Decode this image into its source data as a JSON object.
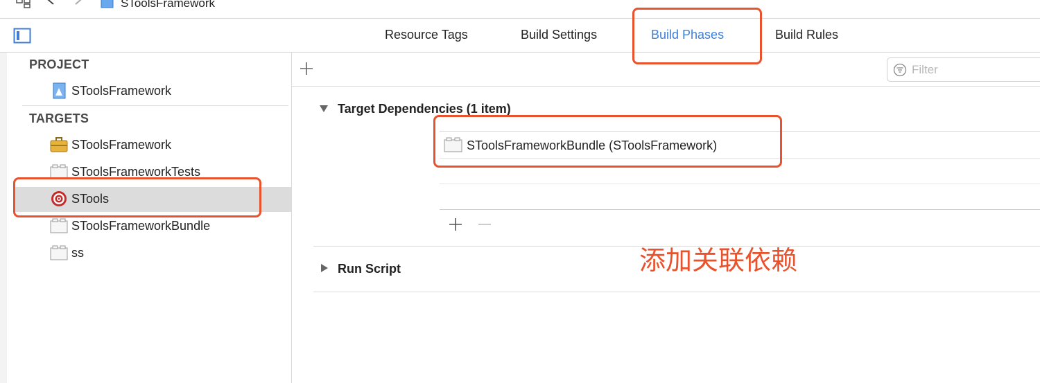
{
  "jumpbar": {
    "crumb": "SToolsFramework"
  },
  "tabs": [
    {
      "label": "Resource Tags"
    },
    {
      "label": "Build Settings"
    },
    {
      "label": "Build Phases",
      "active": true
    },
    {
      "label": "Build Rules"
    }
  ],
  "sidebar": {
    "project_title": "PROJECT",
    "project_item": "SToolsFramework",
    "targets_title": "TARGETS",
    "targets": [
      {
        "label": "SToolsFramework",
        "icon": "toolbox-icon"
      },
      {
        "label": "SToolsFrameworkTests",
        "icon": "bundle-icon"
      },
      {
        "label": "STools",
        "icon": "target-icon",
        "selected": true
      },
      {
        "label": "SToolsFrameworkBundle",
        "icon": "bundle-icon"
      },
      {
        "label": "ss",
        "icon": "bundle-icon"
      }
    ]
  },
  "editor": {
    "filter_placeholder": "Filter",
    "phases": [
      {
        "title": "Target Dependencies (1 item)",
        "expanded": true,
        "items": [
          {
            "label": "SToolsFrameworkBundle (SToolsFramework)"
          }
        ]
      },
      {
        "title": "Run Script",
        "expanded": false
      }
    ]
  },
  "annotation_text": "添加关联依赖",
  "colors": {
    "accent": "#3e7ed8",
    "annotation": "#e8522c",
    "selection": "#dcdcdc"
  }
}
